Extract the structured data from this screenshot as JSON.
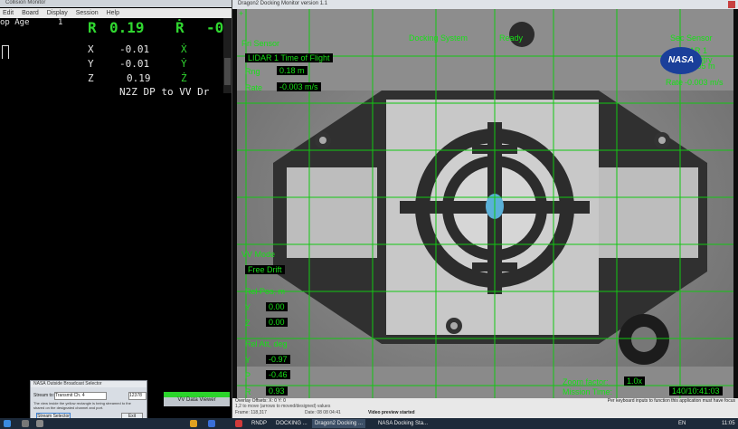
{
  "left_window": {
    "title": "Collision Monitor",
    "menu": [
      "Edit",
      "Board",
      "Display",
      "Session",
      "Help"
    ],
    "age_label": "op Age",
    "age_value": "1",
    "r_label": "R",
    "r_value": "0.19",
    "rdot_label": "Ṙ",
    "rdot_value": "-0",
    "rows": [
      {
        "axis": "X",
        "value": "-0.01",
        "rate_axis": "Ẋ"
      },
      {
        "axis": "Y",
        "value": "-0.01",
        "rate_axis": "Ẏ"
      },
      {
        "axis": "Z",
        "value": "0.19",
        "rate_axis": "Ż"
      }
    ],
    "mode_text": "N2Z DP to VV Dr"
  },
  "video_window": {
    "title": "Dragon2 Docking Monitor version 1.1",
    "pri_sensor": "Pri Sensor",
    "pri_lidar": "LIDAR 1 Time of Flight",
    "rng_label": "Rng",
    "rng_value": "0.18 m",
    "rate_label": "Rate",
    "rate_value": "-0.003 m/s",
    "docking_system": "Docking System",
    "ready": "Ready",
    "sec_sensor": "Sec Sensor",
    "sec_lidar": "LIDAR 1 Geometry",
    "sec_rng_value": ".05 m",
    "sec_rate_label": "Rate",
    "sec_rate_value": "-0.003 m/s",
    "nasa": "NASA",
    "vv_mode": "VV Mode",
    "free_drift": "Free Drift",
    "rel_pos": "Rel Pos, m",
    "pos_rows": [
      {
        "axis": "Y",
        "value": "0.00"
      },
      {
        "axis": "Z",
        "value": "0.00"
      }
    ],
    "rel_att": "Rel Att, deg",
    "att_rows": [
      {
        "axis": "Y",
        "value": "-0.97"
      },
      {
        "axis": "P",
        "value": "-0.46"
      },
      {
        "axis": "R",
        "value": "0.93"
      }
    ],
    "zoom_label": "Zoom factor:",
    "zoom_value": "1.0x",
    "mission_label": "Mission Time:",
    "mission_value": "140/10:41:03",
    "right_note": "Per keyboard inputs to function this application must have focus"
  },
  "status_bar": {
    "offsets": "Overlay Offsets:   X: 0    Y: 0",
    "hint": "1,2 to move (arrows to moved/designed) values",
    "frame": "Frame: 118,317",
    "date": "Date: 08 08 04:41",
    "preview": "Video preview started"
  },
  "popup": {
    "title": "NASA Outside Broadcast Selector",
    "stream_label": "Stream to:",
    "stream_value": "Transmit Ch. 4",
    "port_value": "12378",
    "desc": "The view inside the yellow rectangle is being streamed to the shared on the designated channel and port.",
    "button": "Stream Selector",
    "button2": "Exit"
  },
  "green_label": "VV Data Viewer",
  "taskbar": {
    "items": [
      "RNDP",
      "DOCKING ...",
      "Dragon2 Docking ...",
      "NASA Docking Sta..."
    ],
    "lang": "EN",
    "time": "11:05"
  }
}
